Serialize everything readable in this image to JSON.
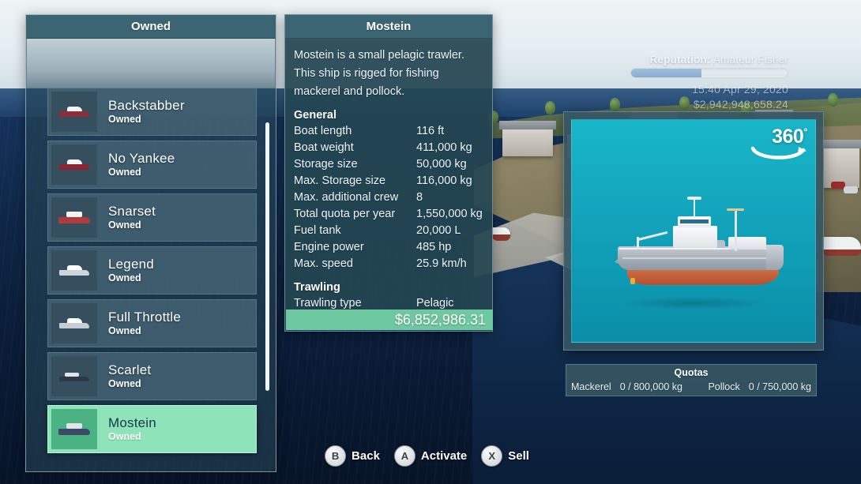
{
  "hud": {
    "reputation_label": "Reputation:",
    "reputation_rank": "Amateur Fisher",
    "reputation_percent": 45,
    "clock": "15:40 Apr 29, 2020",
    "money": "$2,942,948,658.24"
  },
  "owned": {
    "title": "Owned",
    "status_label": "Owned",
    "boats": [
      {
        "name": "Backstabber",
        "status": "Owned",
        "selected": false,
        "hull": "#8c2f3a",
        "deck": "#f2f4f5",
        "kind": "yacht"
      },
      {
        "name": "No Yankee",
        "status": "Owned",
        "selected": false,
        "hull": "#8c2431",
        "deck": "#f2f4f5",
        "kind": "yacht"
      },
      {
        "name": "Snarset",
        "status": "Owned",
        "selected": false,
        "hull": "#b33a3a",
        "deck": "#f2f4f5",
        "kind": "trawler"
      },
      {
        "name": "Legend",
        "status": "Owned",
        "selected": false,
        "hull": "#cfd6db",
        "deck": "#ffffff",
        "kind": "yacht"
      },
      {
        "name": "Full Throttle",
        "status": "Owned",
        "selected": false,
        "hull": "#c6ced4",
        "deck": "#ffffff",
        "kind": "yacht"
      },
      {
        "name": "Scarlet",
        "status": "Owned",
        "selected": false,
        "hull": "#2c3a46",
        "deck": "#dfe5ea",
        "kind": "speed"
      },
      {
        "name": "Mostein",
        "status": "Owned",
        "selected": true,
        "hull": "#3b4a66",
        "deck": "#dfe5ea",
        "kind": "trawler"
      }
    ]
  },
  "detail": {
    "title": "Mostein",
    "description": "Mostein is a small pelagic trawler. This ship is rigged for fishing mackerel and pollock.",
    "sections": [
      {
        "heading": "General",
        "stats": [
          {
            "key": "Boat length",
            "value": "116 ft"
          },
          {
            "key": "Boat weight",
            "value": "411,000 kg"
          },
          {
            "key": "Storage size",
            "value": "50,000 kg"
          },
          {
            "key": "Max. Storage size",
            "value": "116,000 kg"
          },
          {
            "key": "Max. additional crew",
            "value": "8"
          },
          {
            "key": "Total quota per year",
            "value": "1,550,000 kg"
          },
          {
            "key": "Fuel tank",
            "value": "20,000 L"
          },
          {
            "key": "Engine power",
            "value": "485 hp"
          },
          {
            "key": "Max. speed",
            "value": "25.9 km/h"
          }
        ]
      },
      {
        "heading": "Trawling",
        "stats": [
          {
            "key": "Trawling type",
            "value": "Pelagic"
          }
        ]
      }
    ],
    "price": "$6,852,986.31",
    "price_color": "#6fc9a0"
  },
  "viewer": {
    "badge": "360",
    "badge_degree": "°"
  },
  "quotas": {
    "title": "Quotas",
    "entries": [
      {
        "name": "Mackerel",
        "value": "0 / 800,000 kg"
      },
      {
        "name": "Pollock",
        "value": "0 / 750,000 kg"
      }
    ]
  },
  "actions": [
    {
      "button": "B",
      "label": "Back"
    },
    {
      "button": "A",
      "label": "Activate"
    },
    {
      "button": "X",
      "label": "Sell"
    }
  ]
}
